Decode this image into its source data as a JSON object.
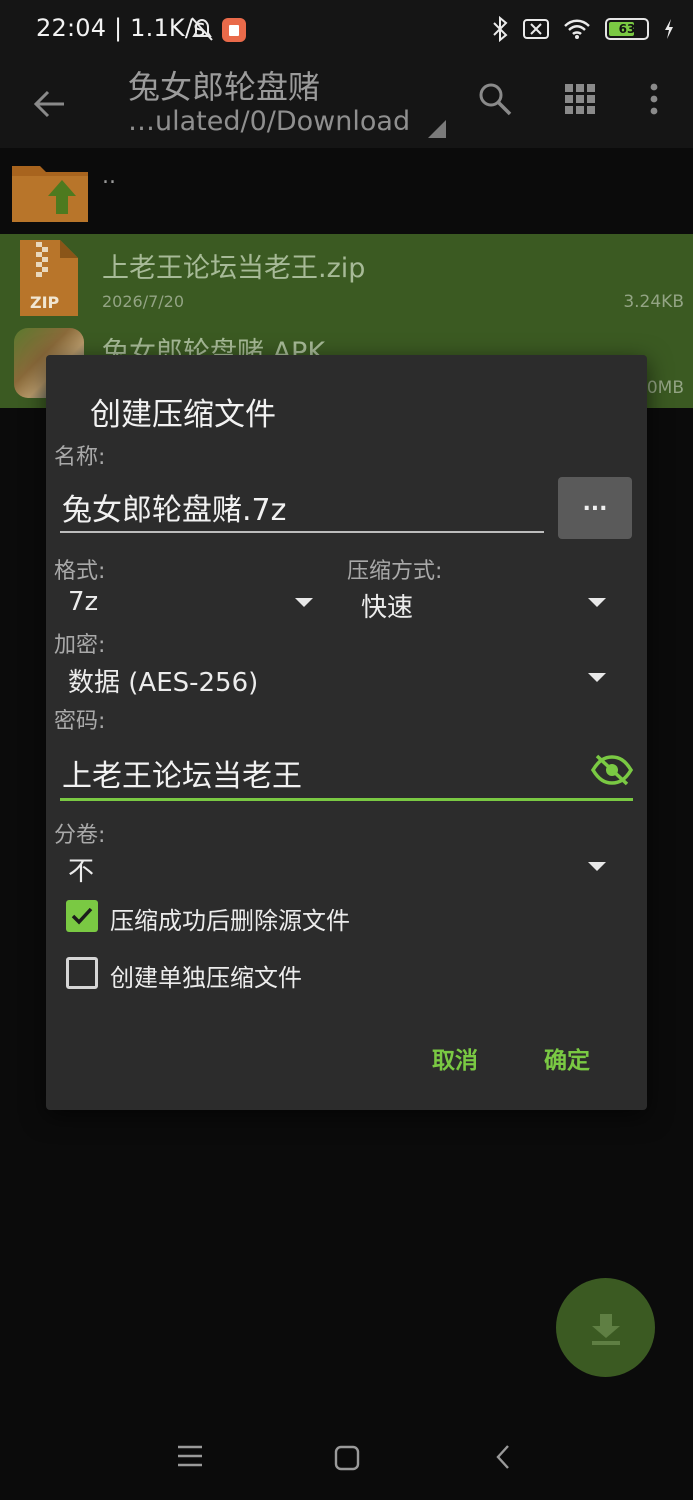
{
  "status_bar": {
    "time": "22:04",
    "speed": "1.1K/s",
    "battery": "63",
    "icons": [
      "bell-off-icon",
      "app-notification-icon",
      "bluetooth-icon",
      "sim-off-icon",
      "wifi-icon",
      "battery-icon",
      "charging-icon"
    ]
  },
  "appbar": {
    "title": "兔女郎轮盘赌",
    "path": "…ulated/0/Download",
    "icons": [
      "back-arrow-icon",
      "search-icon",
      "grid-view-icon",
      "more-vert-icon"
    ]
  },
  "files": {
    "parent": "..",
    "items": [
      {
        "name": "上老王论坛当老王.zip",
        "date": "2026/7/20",
        "size": "3.24KB",
        "icon": "zip-file-icon"
      },
      {
        "name": "兔女郎轮盘赌.APK",
        "size": "0MB",
        "icon": "apk-thumbnail"
      }
    ]
  },
  "dialog": {
    "title": "创建压缩文件",
    "name_label": "名称:",
    "name_value": "兔女郎轮盘赌.7z",
    "browse_label": "...",
    "format_label": "格式:",
    "format_value": "7z",
    "method_label": "压缩方式:",
    "method_value": "快速",
    "encrypt_label": "加密:",
    "encrypt_value": "数据 (AES-256)",
    "password_label": "密码:",
    "password_value": "上老王论坛当老王",
    "volume_label": "分卷:",
    "volume_value": "不",
    "delete_source_label": "压缩成功后删除源文件",
    "delete_source_checked": true,
    "separate_label": "创建单独压缩文件",
    "separate_checked": false,
    "cancel_label": "取消",
    "ok_label": "确定"
  },
  "colors": {
    "accent": "#7ac943",
    "selection_bg": "#3b5a22",
    "dialog_bg": "#2c2c2c"
  }
}
